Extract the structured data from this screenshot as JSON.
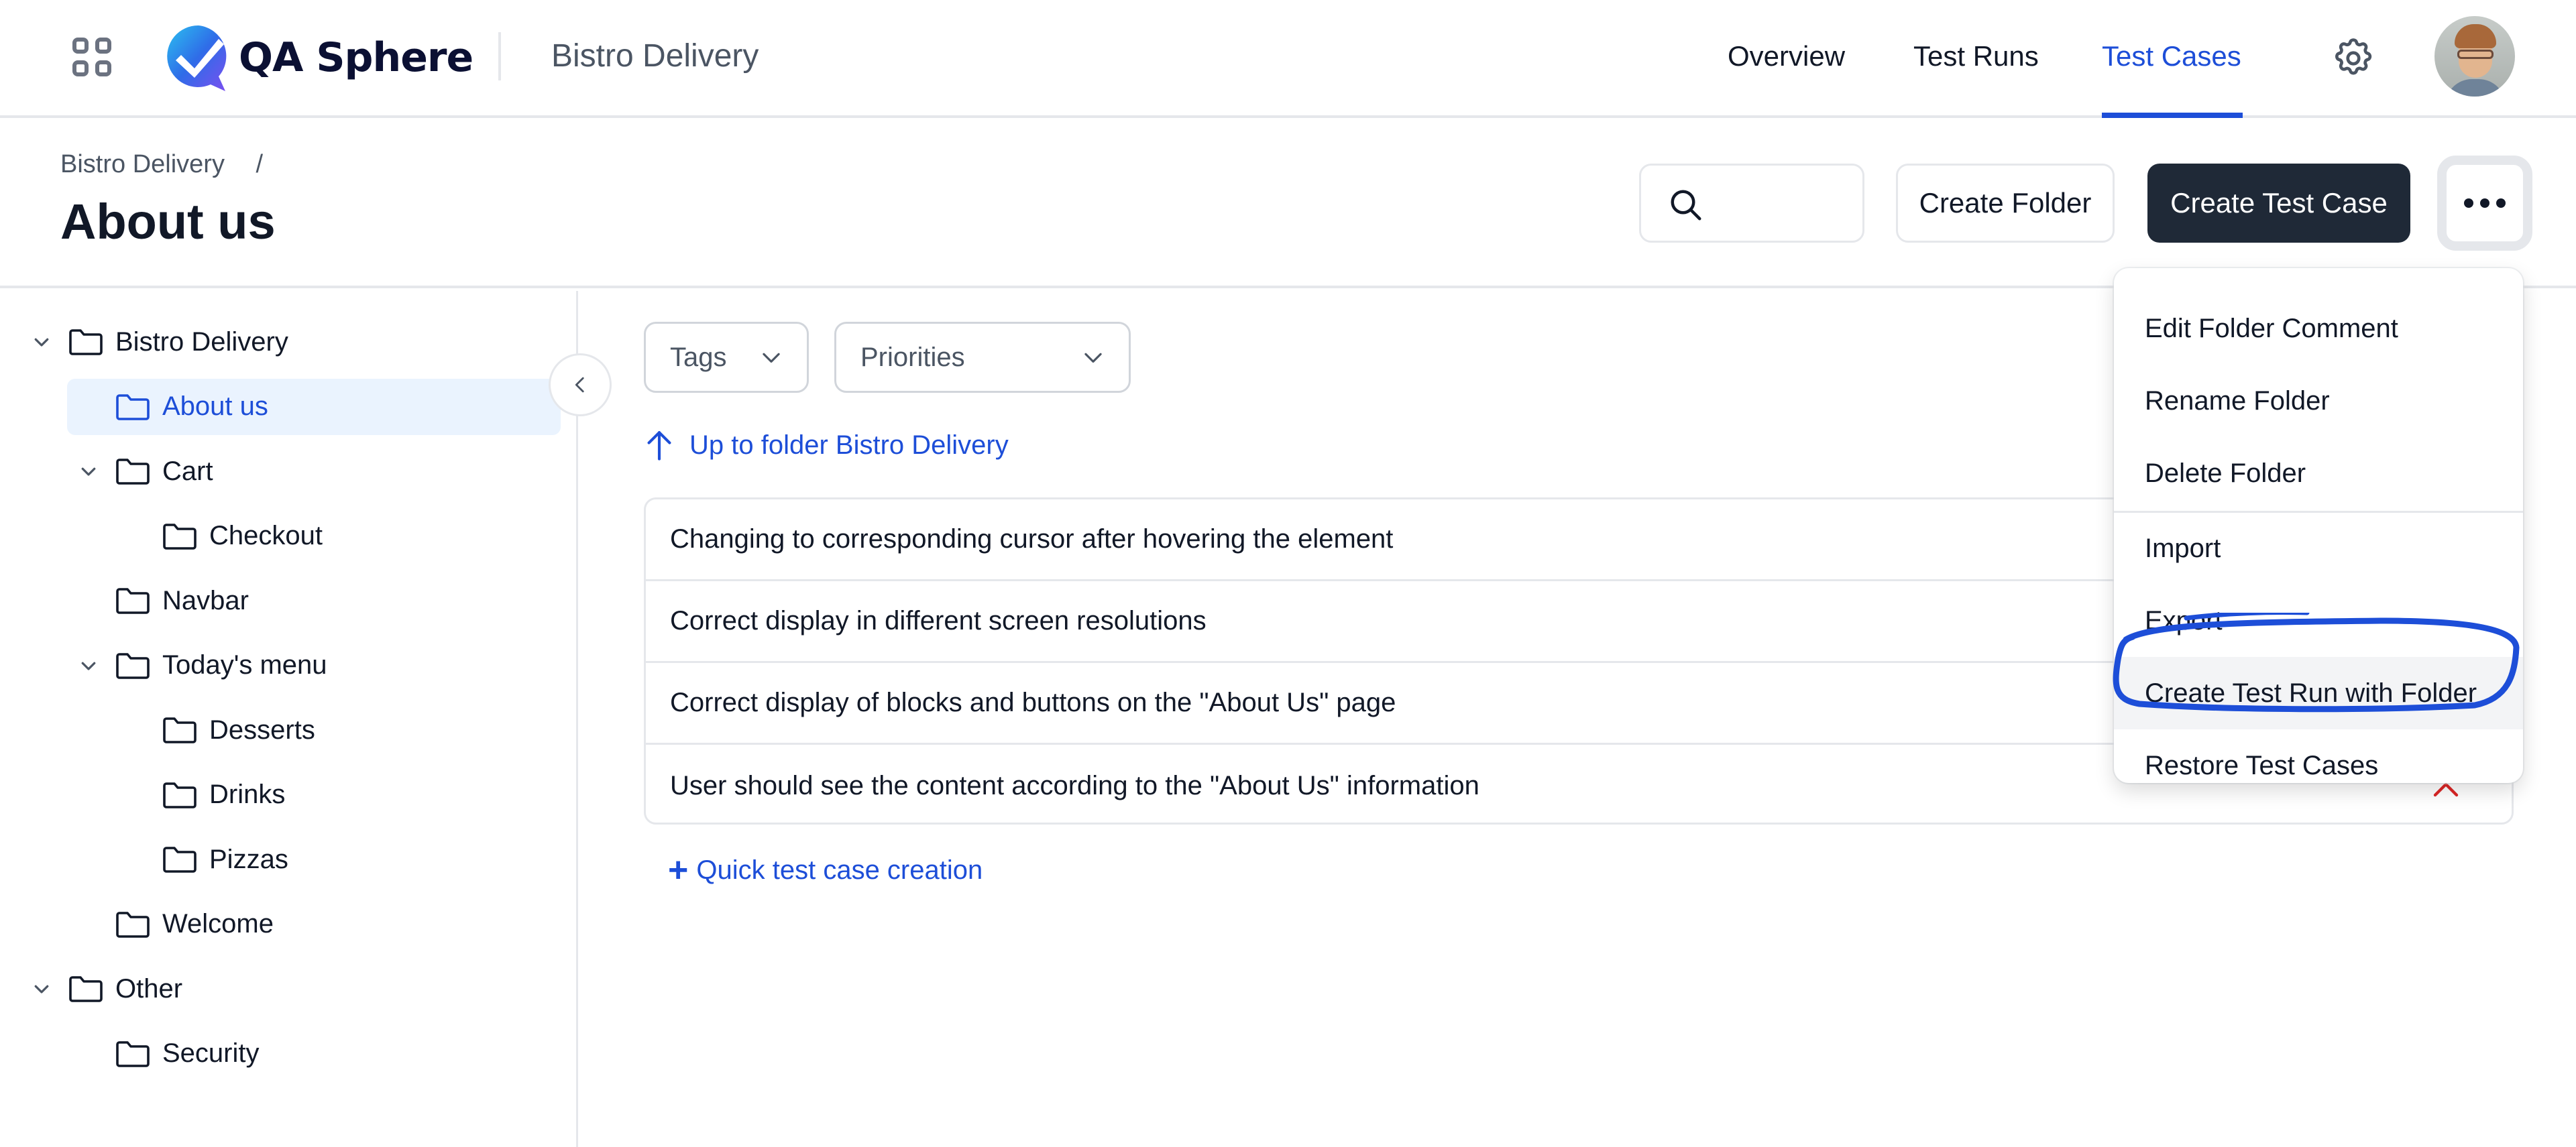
{
  "topnav": {
    "app_name": "QA Sphere",
    "project_name": "Bistro Delivery",
    "tabs": [
      {
        "label": "Overview",
        "active": false
      },
      {
        "label": "Test Runs",
        "active": false
      },
      {
        "label": "Test Cases",
        "active": true
      }
    ],
    "icons": {
      "apps": "apps-grid-icon",
      "settings": "gear-icon",
      "avatar": "user-avatar"
    },
    "accent_color": "#1d4ed8"
  },
  "header": {
    "breadcrumb": [
      {
        "label": "Bistro Delivery"
      }
    ],
    "breadcrumb_separator": "/",
    "title": "About us",
    "search": {
      "value": "",
      "placeholder": ""
    },
    "buttons": {
      "create_folder": "Create Folder",
      "create_test_case": "Create Test Case",
      "more": "more-options"
    }
  },
  "sidebar": {
    "tree": [
      {
        "label": "Bistro Delivery",
        "level": 0,
        "expandable": true,
        "expanded": true,
        "selected": false
      },
      {
        "label": "About us",
        "level": 1,
        "expandable": false,
        "selected": true
      },
      {
        "label": "Cart",
        "level": 1,
        "expandable": true,
        "expanded": true,
        "selected": false
      },
      {
        "label": "Checkout",
        "level": 2,
        "expandable": false,
        "selected": false
      },
      {
        "label": "Navbar",
        "level": 1,
        "expandable": false,
        "selected": false
      },
      {
        "label": "Today's menu",
        "level": 1,
        "expandable": true,
        "expanded": true,
        "selected": false
      },
      {
        "label": "Desserts",
        "level": 2,
        "expandable": false,
        "selected": false
      },
      {
        "label": "Drinks",
        "level": 2,
        "expandable": false,
        "selected": false
      },
      {
        "label": "Pizzas",
        "level": 2,
        "expandable": false,
        "selected": false
      },
      {
        "label": "Welcome",
        "level": 1,
        "expandable": false,
        "selected": false
      },
      {
        "label": "Other",
        "level": 0,
        "expandable": true,
        "expanded": true,
        "selected": false
      },
      {
        "label": "Security",
        "level": 1,
        "expandable": false,
        "selected": false
      }
    ]
  },
  "main": {
    "filters": {
      "tags": "Tags",
      "priorities": "Priorities"
    },
    "up_link": "Up to folder Bistro Delivery",
    "test_cases": [
      {
        "title": "Changing to corresponding cursor after hovering the element"
      },
      {
        "title": "Correct display in different screen resolutions"
      },
      {
        "title": "Correct display of blocks and buttons on the \"About Us\" page"
      },
      {
        "title": "User should see the content according to the \"About Us\" information",
        "priority": "high",
        "priority_color": "#dc2626"
      }
    ],
    "quick_create": {
      "icon": "+",
      "label": "Quick test case creation"
    }
  },
  "menu": {
    "groups": [
      [
        {
          "label": "Edit Folder Comment"
        },
        {
          "label": "Rename Folder"
        },
        {
          "label": "Delete Folder"
        }
      ],
      [
        {
          "label": "Import"
        },
        {
          "label": "Export"
        },
        {
          "label": "Create Test Run with Folder",
          "highlighted": true
        },
        {
          "label": "Restore Test Cases"
        }
      ]
    ],
    "annotation_color": "#1d4ed8"
  }
}
